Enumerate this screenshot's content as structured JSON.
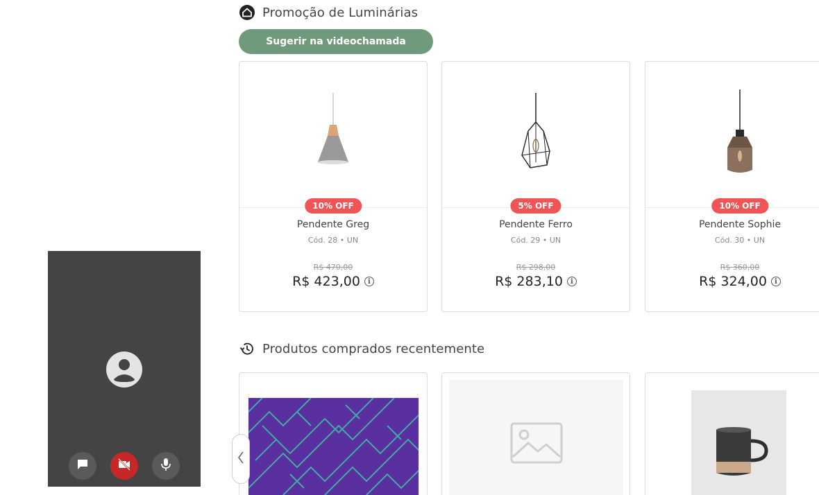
{
  "promo": {
    "title": "Promoção de Luminárias",
    "suggest_label": "Sugerir na videochamada",
    "products": [
      {
        "name": "Pendente Greg",
        "code": "Cód. 28 • UN",
        "badge": "10% OFF",
        "old_price": "R$ 470,00",
        "price": "R$ 423,00",
        "image": "lamp-cone-gray"
      },
      {
        "name": "Pendente Ferro",
        "code": "Cód. 29 • UN",
        "badge": "5% OFF",
        "old_price": "R$ 298,00",
        "price": "R$ 283,10",
        "image": "lamp-wire-geometric"
      },
      {
        "name": "Pendente Sophie",
        "code": "Cód. 30 • UN",
        "badge": "10% OFF",
        "old_price": "R$ 360,00",
        "price": "R$ 324,00",
        "image": "lamp-glass-bronze"
      }
    ]
  },
  "recent": {
    "title": "Produtos comprados recentemente",
    "products": [
      {
        "image": "purple-pattern-fabric"
      },
      {
        "image": "image-placeholder-icon"
      },
      {
        "image": "black-mug"
      }
    ]
  },
  "video": {
    "avatar_icon": "user-avatar-icon",
    "controls": [
      "chat-icon",
      "camera-off-icon",
      "microphone-icon"
    ]
  },
  "colors": {
    "accent": "#6f9a7b",
    "badge": "#f05454",
    "video_bg": "#444444",
    "camera_off": "#c62828"
  }
}
